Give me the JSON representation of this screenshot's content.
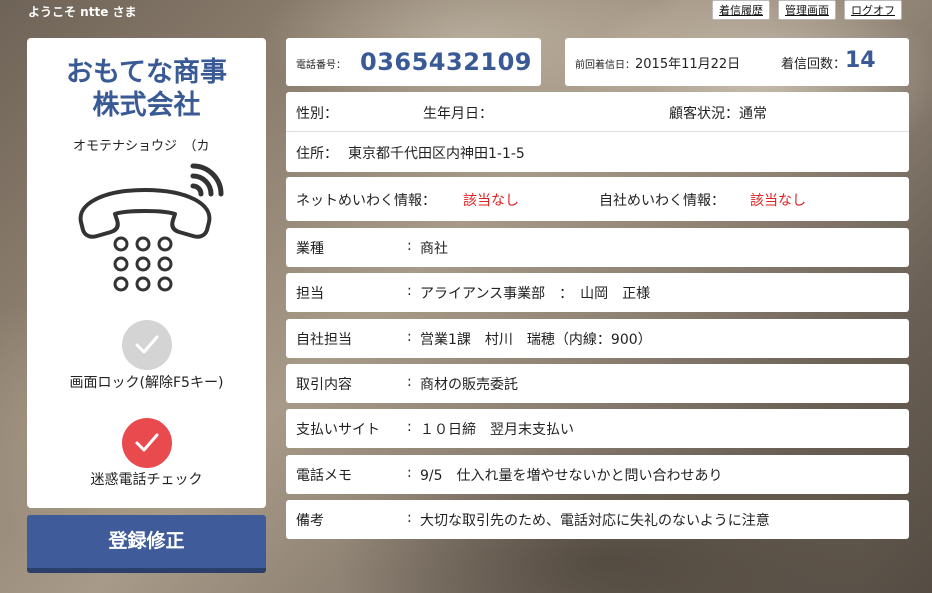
{
  "header": {
    "greeting": "ようこそ ntte さま",
    "nav": [
      "着信履歴",
      "管理画面",
      "ログオフ"
    ]
  },
  "customer": {
    "name_line1": "おもてな商事",
    "name_line2": "株式会社",
    "kana": "オモテナショウジ　（カ"
  },
  "actions": {
    "lock_label": "画面ロック(解除F5キー)",
    "spam_label": "迷惑電話チェック",
    "register_label": "登録修正"
  },
  "call": {
    "phone_label": "電話番号：",
    "phone_number": "0365432109",
    "last_label": "前回着信日：",
    "last_date": "2015年11月22日",
    "count_label": "着信回数：",
    "count": "14"
  },
  "info": {
    "gender_label": "性別：",
    "birthday_label": "生年月日：",
    "status_label": "顧客状況：",
    "status_value": "通常",
    "address_label": "住所：",
    "address_value": "東京都千代田区内神田1-1-5"
  },
  "nuisance": {
    "net_label": "ネットめいわく情報：",
    "net_value": "該当なし",
    "own_label": "自社めいわく情報：",
    "own_value": "該当なし"
  },
  "rows": [
    {
      "label": "業種",
      "value": "商社"
    },
    {
      "label": "担当",
      "value": "アライアンス事業部　：　山岡　正様"
    },
    {
      "label": "自社担当",
      "value": "営業1課　村川　瑞穂（内線：900）"
    },
    {
      "label": "取引内容",
      "value": "商材の販売委託"
    },
    {
      "label": "支払いサイト",
      "value": "１０日締　翌月末支払い"
    },
    {
      "label": "電話メモ",
      "value": "9/5　仕入れ量を増やせないかと問い合わせあり"
    },
    {
      "label": "備考",
      "value": "大切な取引先のため、電話対応に失礼のないように注意"
    }
  ],
  "colors": {
    "brand_blue": "#3a5a96",
    "button_blue": "#3f5b9a",
    "alert_red": "#e84a4e",
    "lock_gray": "#d4d4d4"
  }
}
